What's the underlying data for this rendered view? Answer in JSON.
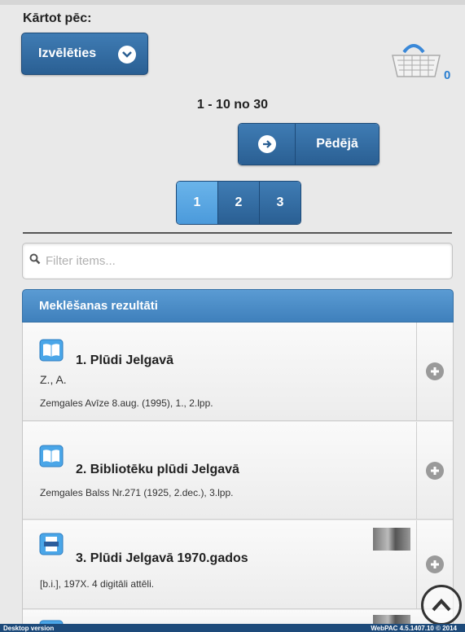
{
  "sort": {
    "label": "Kārtot pēc:",
    "button_label": "Izvēlēties"
  },
  "basket": {
    "count": "0",
    "icon": "basket-icon"
  },
  "pager": {
    "range_text": "1 - 10 no 30",
    "last_label": "Pēdējā",
    "pages": [
      "1",
      "2",
      "3"
    ],
    "active_page": "1"
  },
  "filter": {
    "placeholder": "Filter items..."
  },
  "results": {
    "header": "Meklēšanas rezultāti",
    "items": [
      {
        "title": "1. Plūdi Jelgavā",
        "author": "Z., A.",
        "publication": "Zemgales Avīze 8.aug. (1995), 1., 2.lpp.",
        "icon": "book-icon"
      },
      {
        "title": "2. Bibliotēku plūdi Jelgavā",
        "author": "",
        "publication": "Zemgales Balss Nr.271 (1925, 2.dec.), 3.lpp.",
        "icon": "book-icon"
      },
      {
        "title": "3. Plūdi Jelgavā 1970.gados",
        "author": "",
        "publication": "[b.i.], 197X. 4 digitāli attēli.",
        "icon": "file-icon"
      }
    ]
  },
  "footer": {
    "left": "Desktop version",
    "right": "WebPAC 4.5.1407.10 © 2014"
  },
  "colors": {
    "primary": "#2a5f93",
    "active": "#4b9adb",
    "count": "#2a7fd0"
  }
}
